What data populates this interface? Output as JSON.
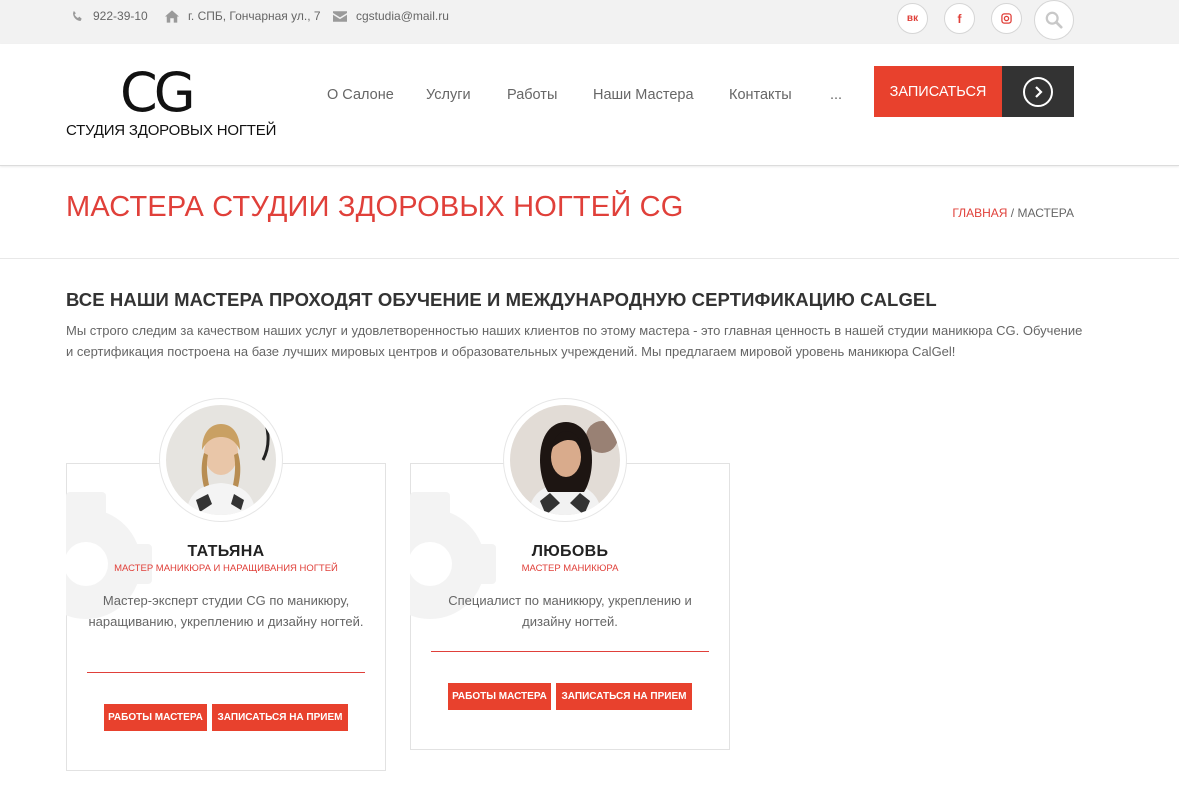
{
  "topbar": {
    "phone": "922-39-10",
    "address": "г. СПБ, Гончарная ул., 7",
    "email": "cgstudia@mail.ru",
    "social": [
      {
        "name": "vk",
        "glyph": "вк"
      },
      {
        "name": "facebook",
        "glyph": "f"
      },
      {
        "name": "instagram",
        "glyph": "◘"
      }
    ]
  },
  "header": {
    "logo_letters": "CG",
    "logo_subtitle": "СТУДИЯ ЗДОРОВЫХ НОГТЕЙ",
    "nav": [
      "О Салоне",
      "Услуги",
      "Работы",
      "Наши Мастера",
      "Контакты",
      "..."
    ],
    "cta_label": "ЗАПИСАТЬСЯ"
  },
  "page": {
    "title": "МАСТЕРА СТУДИИ ЗДОРОВЫХ НОГТЕЙ CG",
    "breadcrumb_home": "ГЛАВНАЯ",
    "breadcrumb_sep": " / ",
    "breadcrumb_current": "МАСТЕРА"
  },
  "intro": {
    "heading": "ВСЕ НАШИ МАСТЕРА ПРОХОДЯТ ОБУЧЕНИЕ И МЕЖДУНАРОДНУЮ СЕРТИФИКАЦИЮ CALGEL",
    "text": "Мы строго следим за качеством наших услуг и удовлетворенностью наших клиентов по этому мастера - это главная ценность в нашей студии маникюра CG. Обучение и сертификация построена на базе лучших мировых центров и образовательных учреждений. Мы предлагаем мировой уровень маникюра CalGel!"
  },
  "masters": [
    {
      "name": "ТАТЬЯНА",
      "role": "Мастер маникюра и наращивания ногтей",
      "description": "Мастер-эксперт студии CG по маникюру, наращиванию, укреплению и дизайну ногтей.",
      "btn_works": "РАБОТЫ МАСТЕРА",
      "btn_book": "ЗАПИСАТЬСЯ НА ПРИЕМ"
    },
    {
      "name": "ЛЮБОВЬ",
      "role": "Мастер маникюра",
      "description": "Специалист по маникюру, укреплению и дизайну ногтей.",
      "btn_works": "РАБОТЫ МАСТЕРА",
      "btn_book": "ЗАПИСАТЬСЯ НА ПРИЕМ"
    }
  ],
  "colors": {
    "accent": "#e8412d",
    "dark": "#333333",
    "topbar_bg": "#f2f2f2"
  }
}
